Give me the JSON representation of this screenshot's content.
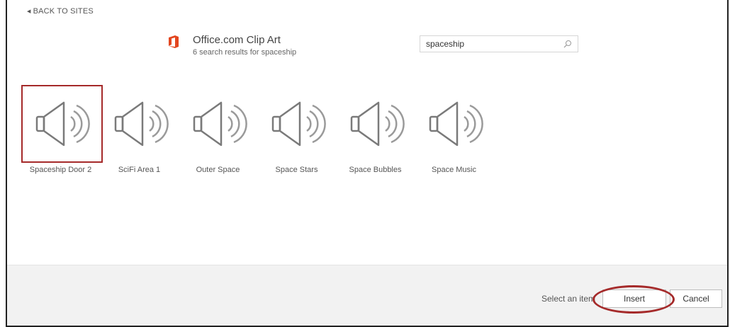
{
  "nav": {
    "back_label": "BACK TO SITES"
  },
  "provider": {
    "title": "Office.com Clip Art",
    "subtitle": "6 search results for spaceship",
    "logo_color": "#e3461f"
  },
  "search": {
    "value": "spaceship",
    "icon": "search-icon"
  },
  "results": [
    {
      "label": "Spaceship Door 2",
      "icon": "speaker-icon",
      "selected": true
    },
    {
      "label": "SciFi Area 1",
      "icon": "speaker-icon",
      "selected": false
    },
    {
      "label": "Outer Space",
      "icon": "speaker-icon",
      "selected": false
    },
    {
      "label": "Space Stars",
      "icon": "speaker-icon",
      "selected": false
    },
    {
      "label": "Space Bubbles",
      "icon": "speaker-icon",
      "selected": false
    },
    {
      "label": "Space Music",
      "icon": "speaker-icon",
      "selected": false
    }
  ],
  "footer": {
    "status": "Select an item",
    "insert_label": "Insert",
    "cancel_label": "Cancel"
  },
  "colors": {
    "selection": "#a52a2a",
    "icon_stroke": "#7a7a7a",
    "footer_bg": "#f2f2f2"
  }
}
